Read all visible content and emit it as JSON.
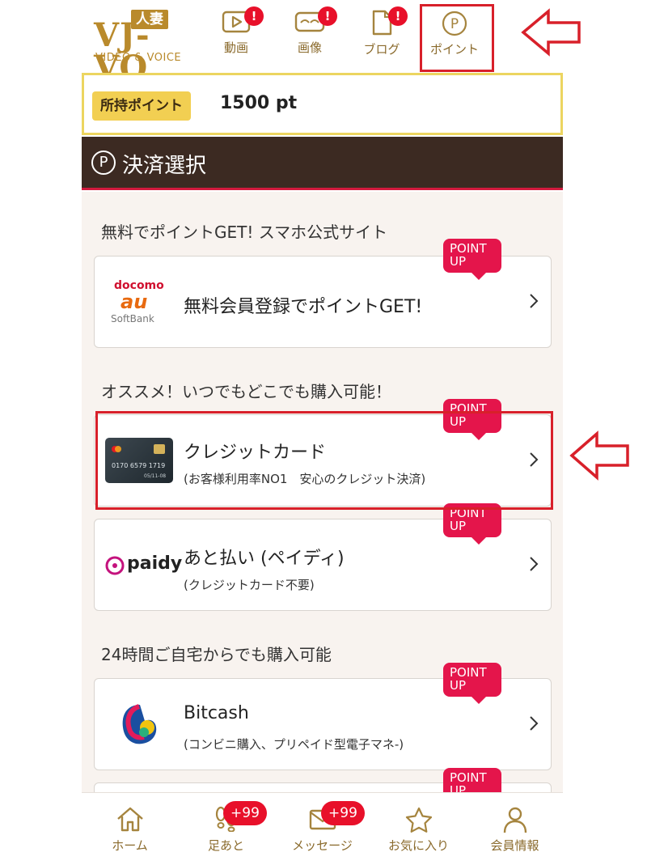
{
  "logo": {
    "tag": "人妻",
    "main": "VJ-VO",
    "sub": "VIDEO & VOICE"
  },
  "top_nav": [
    {
      "label": "動画",
      "badge": "!"
    },
    {
      "label": "画像",
      "badge": "!"
    },
    {
      "label": "ブログ",
      "badge": "!"
    },
    {
      "label": "ポイント"
    }
  ],
  "points": {
    "label": "所持ポイント",
    "value": "1500 pt"
  },
  "section": {
    "icon": "P",
    "title": "決済選択"
  },
  "groups": [
    {
      "title": "無料でポイントGET! スマホ公式サイト"
    },
    {
      "title": "オススメ！いつでもどこでも購入可能！"
    },
    {
      "title": "24時間ご自宅からでも購入可能"
    }
  ],
  "point_up": {
    "line1": "POINT",
    "line2": "UP"
  },
  "cards": [
    {
      "title": "無料会員登録でポイントGET!",
      "sub": "",
      "logo": {
        "docomo": "docomo",
        "au": "au",
        "softbank": "SoftBank"
      }
    },
    {
      "title": "クレジットカード",
      "sub": "(お客様利用率NO1　安心のクレジット決済)",
      "card_number": "0170 6579 1719",
      "card_expiry": "05/11-08"
    },
    {
      "title": "あと払い (ペイディ)",
      "sub": "(クレジットカード不要)",
      "logo_text": "paidy"
    },
    {
      "title": "Bitcash",
      "sub": "(コンビニ購入、プリペイド型電子マネ-)"
    }
  ],
  "bottom_nav": [
    {
      "label": "ホーム"
    },
    {
      "label": "足あと",
      "badge": "+99"
    },
    {
      "label": "メッセージ",
      "badge": "+99"
    },
    {
      "label": "お気に入り"
    },
    {
      "label": "会員情報"
    }
  ],
  "colors": {
    "gold": "#b98a2c",
    "brown": "#3c2a22",
    "accent_red": "#e4154b",
    "highlight": "#d8202a",
    "points_yellow": "#f2cf52"
  }
}
